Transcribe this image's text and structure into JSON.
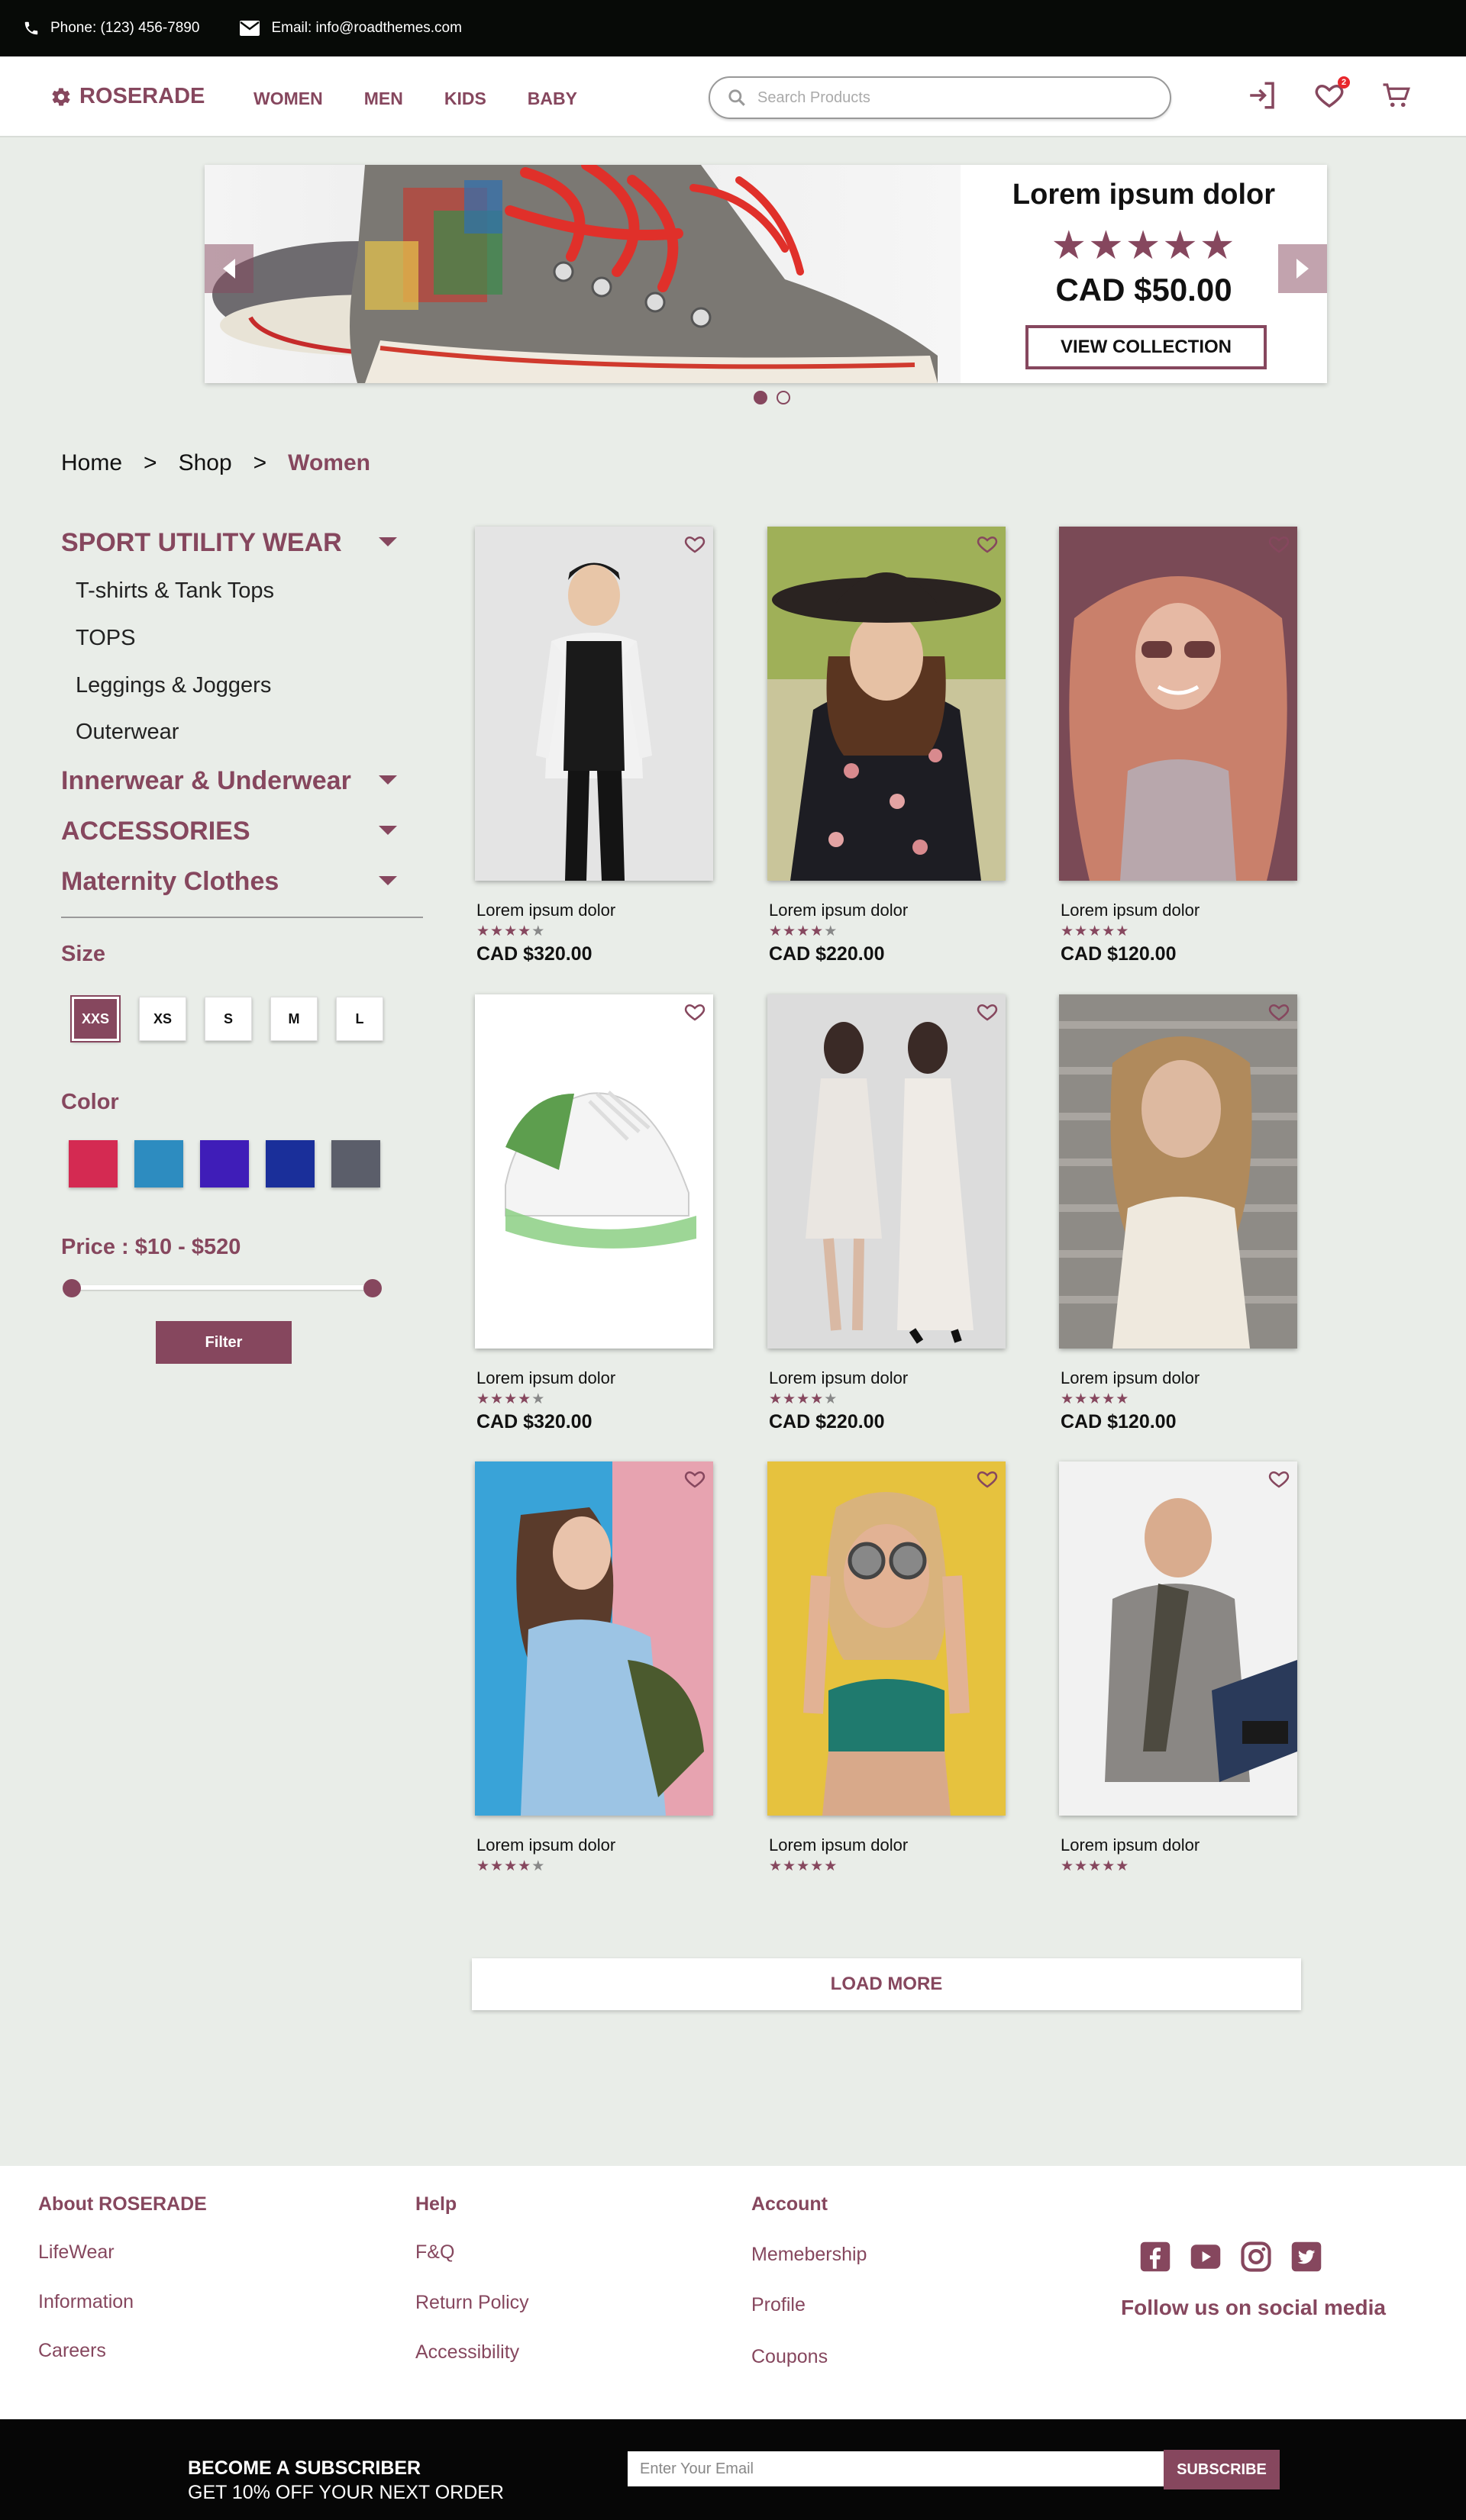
{
  "topbar": {
    "phone": "Phone: (123) 456-7890",
    "email": "Email: info@roadthemes.com"
  },
  "header": {
    "logo": "ROSERADE",
    "nav": [
      "WOMEN",
      "MEN",
      "KIDS",
      "BABY"
    ],
    "search_placeholder": "Search Products",
    "wishlist_count": "2"
  },
  "hero": {
    "title": "Lorem ipsum dolor",
    "stars": "★★★★★",
    "price": "CAD $50.00",
    "button": "VIEW COLLECTION",
    "slides": 2,
    "active_slide": 1
  },
  "breadcrumb": {
    "home": "Home",
    "sep": ">",
    "shop": "Shop",
    "current": "Women"
  },
  "sidebar": {
    "categories": [
      {
        "label": "SPORT UTILITY WEAR",
        "subs": [
          "T-shirts & Tank Tops",
          "TOPS",
          "Leggings & Joggers",
          "Outerwear"
        ]
      },
      {
        "label": "Innerwear & Underwear"
      },
      {
        "label": "ACCESSORIES"
      },
      {
        "label": "Maternity Clothes"
      }
    ],
    "size_heading": "Size",
    "sizes": [
      "XXS",
      "XS",
      "S",
      "M",
      "L"
    ],
    "selected_size": "XXS",
    "color_heading": "Color",
    "colors": [
      "#d42a52",
      "#2d8cc0",
      "#3f1db8",
      "#1a2f9a",
      "#5b5e6a"
    ],
    "price_heading": "Price : $10 - $520",
    "filter_button": "Filter"
  },
  "products": [
    {
      "name": "Lorem ipsum dolor",
      "rating": 4,
      "price": "CAD $320.00"
    },
    {
      "name": "Lorem ipsum dolor",
      "rating": 4,
      "price": "CAD $220.00"
    },
    {
      "name": "Lorem ipsum dolor",
      "rating": 5,
      "price": "CAD $120.00"
    },
    {
      "name": "Lorem ipsum dolor",
      "rating": 4,
      "price": "CAD $320.00"
    },
    {
      "name": "Lorem ipsum dolor",
      "rating": 4,
      "price": "CAD $220.00"
    },
    {
      "name": "Lorem ipsum dolor",
      "rating": 5,
      "price": "CAD $120.00"
    },
    {
      "name": "Lorem ipsum dolor",
      "rating": 4,
      "price": ""
    },
    {
      "name": "Lorem ipsum dolor",
      "rating": 5,
      "price": ""
    },
    {
      "name": "Lorem ipsum dolor",
      "rating": 5,
      "price": ""
    }
  ],
  "load_more": "LOAD MORE",
  "footer": {
    "about": {
      "heading": "About ROSERADE",
      "links": [
        "LifeWear",
        "Information",
        "Careers"
      ]
    },
    "help": {
      "heading": "Help",
      "links": [
        "F&Q",
        "Return Policy",
        "Accessibility"
      ]
    },
    "account": {
      "heading": "Account",
      "links": [
        "Memebership",
        "Profile",
        "Coupons"
      ]
    },
    "social_icons": [
      "facebook-icon",
      "youtube-icon",
      "instagram-icon",
      "twitter-icon"
    ],
    "follow": "Follow us on social media"
  },
  "subscribe": {
    "heading": "BECOME A SUBSCRIBER",
    "subtext": "GET 10% OFF YOUR NEXT ORDER",
    "placeholder": "Enter Your Email",
    "button": "SUBSCRIBE"
  },
  "colors": {
    "accent": "#86475e",
    "topbar": "#070a07",
    "background": "#e9ede8"
  }
}
